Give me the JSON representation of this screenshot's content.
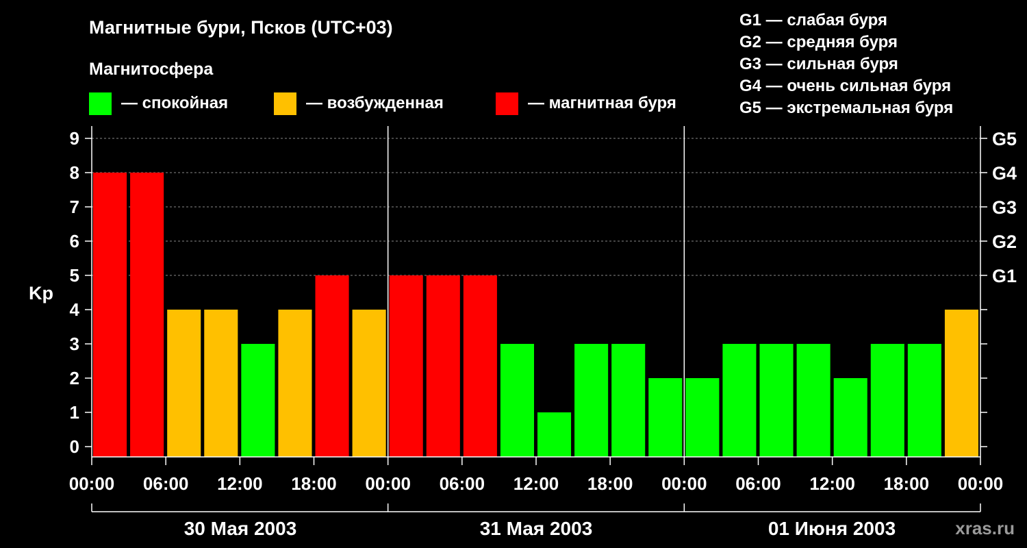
{
  "chart_data": {
    "type": "bar",
    "title": "Магнитные бури, Псков (UTC+03)",
    "subtitle": "Магнитосфера",
    "ylabel": "Kp",
    "ylim": [
      0,
      9
    ],
    "y_ticks": [
      "0",
      "1",
      "2",
      "3",
      "4",
      "5",
      "6",
      "7",
      "8",
      "9"
    ],
    "right_ticks": [
      {
        "kp": 5,
        "label": "G1"
      },
      {
        "kp": 6,
        "label": "G2"
      },
      {
        "kp": 7,
        "label": "G3"
      },
      {
        "kp": 8,
        "label": "G4"
      },
      {
        "kp": 9,
        "label": "G5"
      }
    ],
    "x_tick_labels": [
      "00:00",
      "06:00",
      "12:00",
      "18:00",
      "00:00",
      "06:00",
      "12:00",
      "18:00",
      "00:00",
      "06:00",
      "12:00",
      "18:00",
      "00:00"
    ],
    "days": [
      "30 Мая 2003",
      "31 Мая 2003",
      "01 Июня 2003"
    ],
    "values": [
      8,
      8,
      4,
      4,
      3,
      4,
      5,
      4,
      5,
      5,
      5,
      3,
      1,
      3,
      3,
      2,
      2,
      3,
      3,
      3,
      2,
      3,
      3,
      4
    ],
    "grid": "dashed at Kp 5–9",
    "legend": [
      {
        "label": "— спокойная",
        "color": "#00ff00"
      },
      {
        "label": "— возбужденная",
        "color": "#ffc000"
      },
      {
        "label": "— магнитная буря",
        "color": "#ff0000"
      }
    ],
    "storm_levels": [
      "G1 — слабая буря",
      "G2 — средняя буря",
      "G3 — сильная буря",
      "G4 — очень сильная буря",
      "G5 — экстремальная буря"
    ],
    "colors": {
      "quiet": "#00ff00",
      "active": "#ffc000",
      "storm": "#ff0000",
      "background": "#000000"
    },
    "watermark": "xras.ru"
  }
}
